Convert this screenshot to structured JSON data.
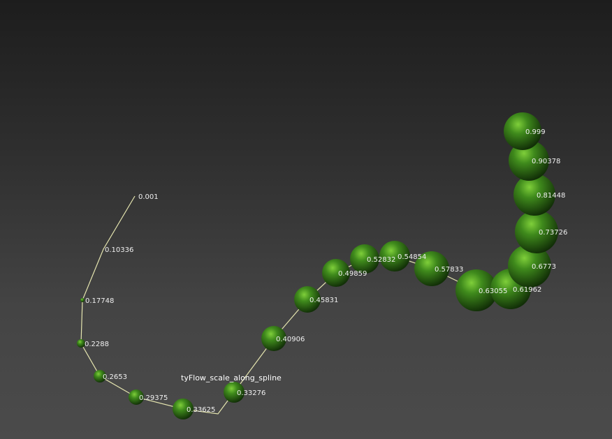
{
  "viewport": {
    "object_name": "tyFlow_scale_along_spline",
    "colors": {
      "spline": "#e6e6b0",
      "sphere_light": "#7fcf3a",
      "sphere_mid": "#3f8a1c",
      "sphere_dark": "#0f2a06",
      "label": "#f0f0f0"
    },
    "markers": [
      {
        "label": "0.001",
        "sphere": false
      },
      {
        "label": "0.10336",
        "sphere": false
      },
      {
        "label": "0.17748",
        "sphere": true
      },
      {
        "label": "0.2288",
        "sphere": true
      },
      {
        "label": "0.2653",
        "sphere": true
      },
      {
        "label": "0.29375",
        "sphere": true
      },
      {
        "label": "0.33625",
        "sphere": true
      },
      {
        "label": "0.33276",
        "sphere": true
      },
      {
        "label": "0.40906",
        "sphere": true
      },
      {
        "label": "0.45831",
        "sphere": true
      },
      {
        "label": "0.49859",
        "sphere": true
      },
      {
        "label": "0.52832",
        "sphere": true
      },
      {
        "label": "0.54854",
        "sphere": true
      },
      {
        "label": "0.57833",
        "sphere": true
      },
      {
        "label": "0.63055",
        "sphere": true
      },
      {
        "label": "0.61962",
        "sphere": true
      },
      {
        "label": "0.6773",
        "sphere": true
      },
      {
        "label": "0.73726",
        "sphere": true
      },
      {
        "label": "0.81448",
        "sphere": true
      },
      {
        "label": "0.90378",
        "sphere": true
      },
      {
        "label": "0.999",
        "sphere": true
      }
    ]
  }
}
